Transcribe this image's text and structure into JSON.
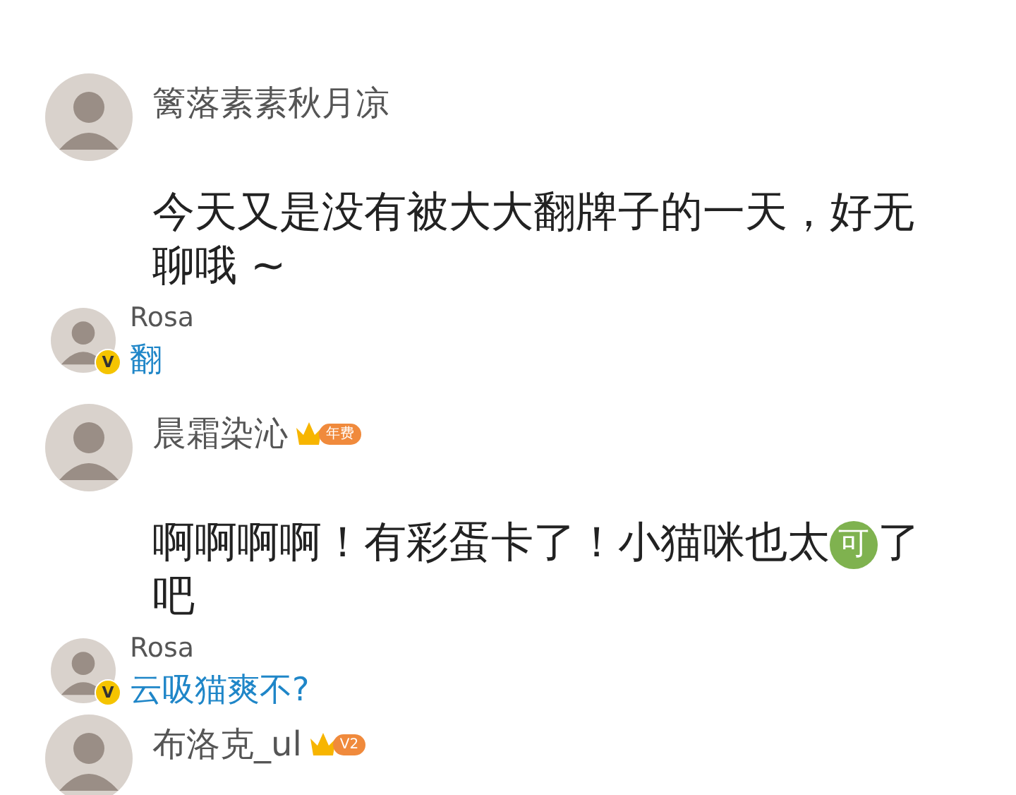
{
  "comments": [
    {
      "username": "篱落素素秋月凉",
      "body": [
        {
          "kind": "text",
          "text": "今天又是没有被大大翻牌子的一天，好无聊哦 ~"
        }
      ],
      "reply": {
        "username": "Rosa",
        "verified_mark": "V",
        "text": "翻"
      }
    },
    {
      "username": "晨霜染沁",
      "badge": {
        "label": "年费"
      },
      "body": [
        {
          "kind": "text",
          "text": "啊啊啊啊！有彩蛋卡了！小猫咪也太"
        },
        {
          "kind": "emoji",
          "text": "可"
        },
        {
          "kind": "text",
          "text": "了吧"
        }
      ],
      "reply": {
        "username": "Rosa",
        "verified_mark": "V",
        "text": "云吸猫爽不?"
      }
    },
    {
      "username": "布洛克_ul",
      "badge": {
        "label": "V2"
      }
    }
  ]
}
